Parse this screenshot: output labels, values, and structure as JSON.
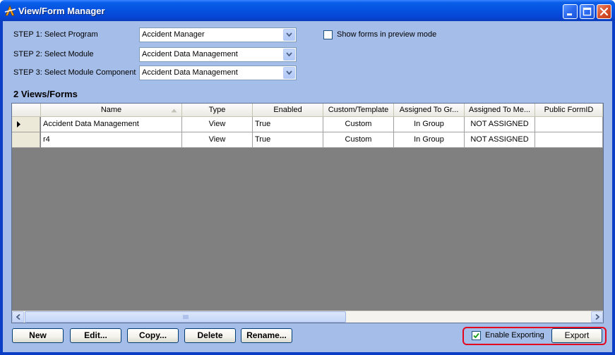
{
  "window": {
    "title": "View/Form Manager"
  },
  "steps": [
    {
      "label": "STEP 1: Select Program",
      "value": "Accident Manager"
    },
    {
      "label": "STEP 2: Select Module",
      "value": "Accident Data Management"
    },
    {
      "label": "STEP 3: Select Module Component",
      "value": "Accident Data Management"
    }
  ],
  "preview": {
    "label": "Show forms in preview mode",
    "checked": false
  },
  "section": {
    "title": "2 Views/Forms"
  },
  "grid": {
    "columns": [
      "Name",
      "Type",
      "Enabled",
      "Custom/Template",
      "Assigned To Gr...",
      "Assigned To Me...",
      "Public FormID"
    ],
    "sorted_column": "Name",
    "rows": [
      [
        "Accident Data Management",
        "View",
        "True",
        "Custom",
        "In Group",
        "NOT ASSIGNED",
        ""
      ],
      [
        "r4",
        "View",
        "True",
        "Custom",
        "In Group",
        "NOT ASSIGNED",
        ""
      ]
    ],
    "selected_row": 0
  },
  "buttons": {
    "new": "New",
    "edit": "Edit...",
    "copy": "Copy...",
    "delete": "Delete",
    "rename": "Rename...",
    "export": "Export"
  },
  "exporting": {
    "label": "Enable Exporting",
    "checked": true
  },
  "colors": {
    "client_bg": "#a5bde9",
    "highlight_ring": "#e3061f",
    "titlebar": "#0553e0"
  },
  "icons": {
    "app": "app-logo-icon",
    "minimize": "minimize-icon",
    "maximize": "maximize-icon",
    "close": "close-icon",
    "dropdown": "chevron-down-icon",
    "row_pointer": "row-pointer-icon",
    "sort": "sort-ascending-icon",
    "check": "checkmark-icon"
  }
}
